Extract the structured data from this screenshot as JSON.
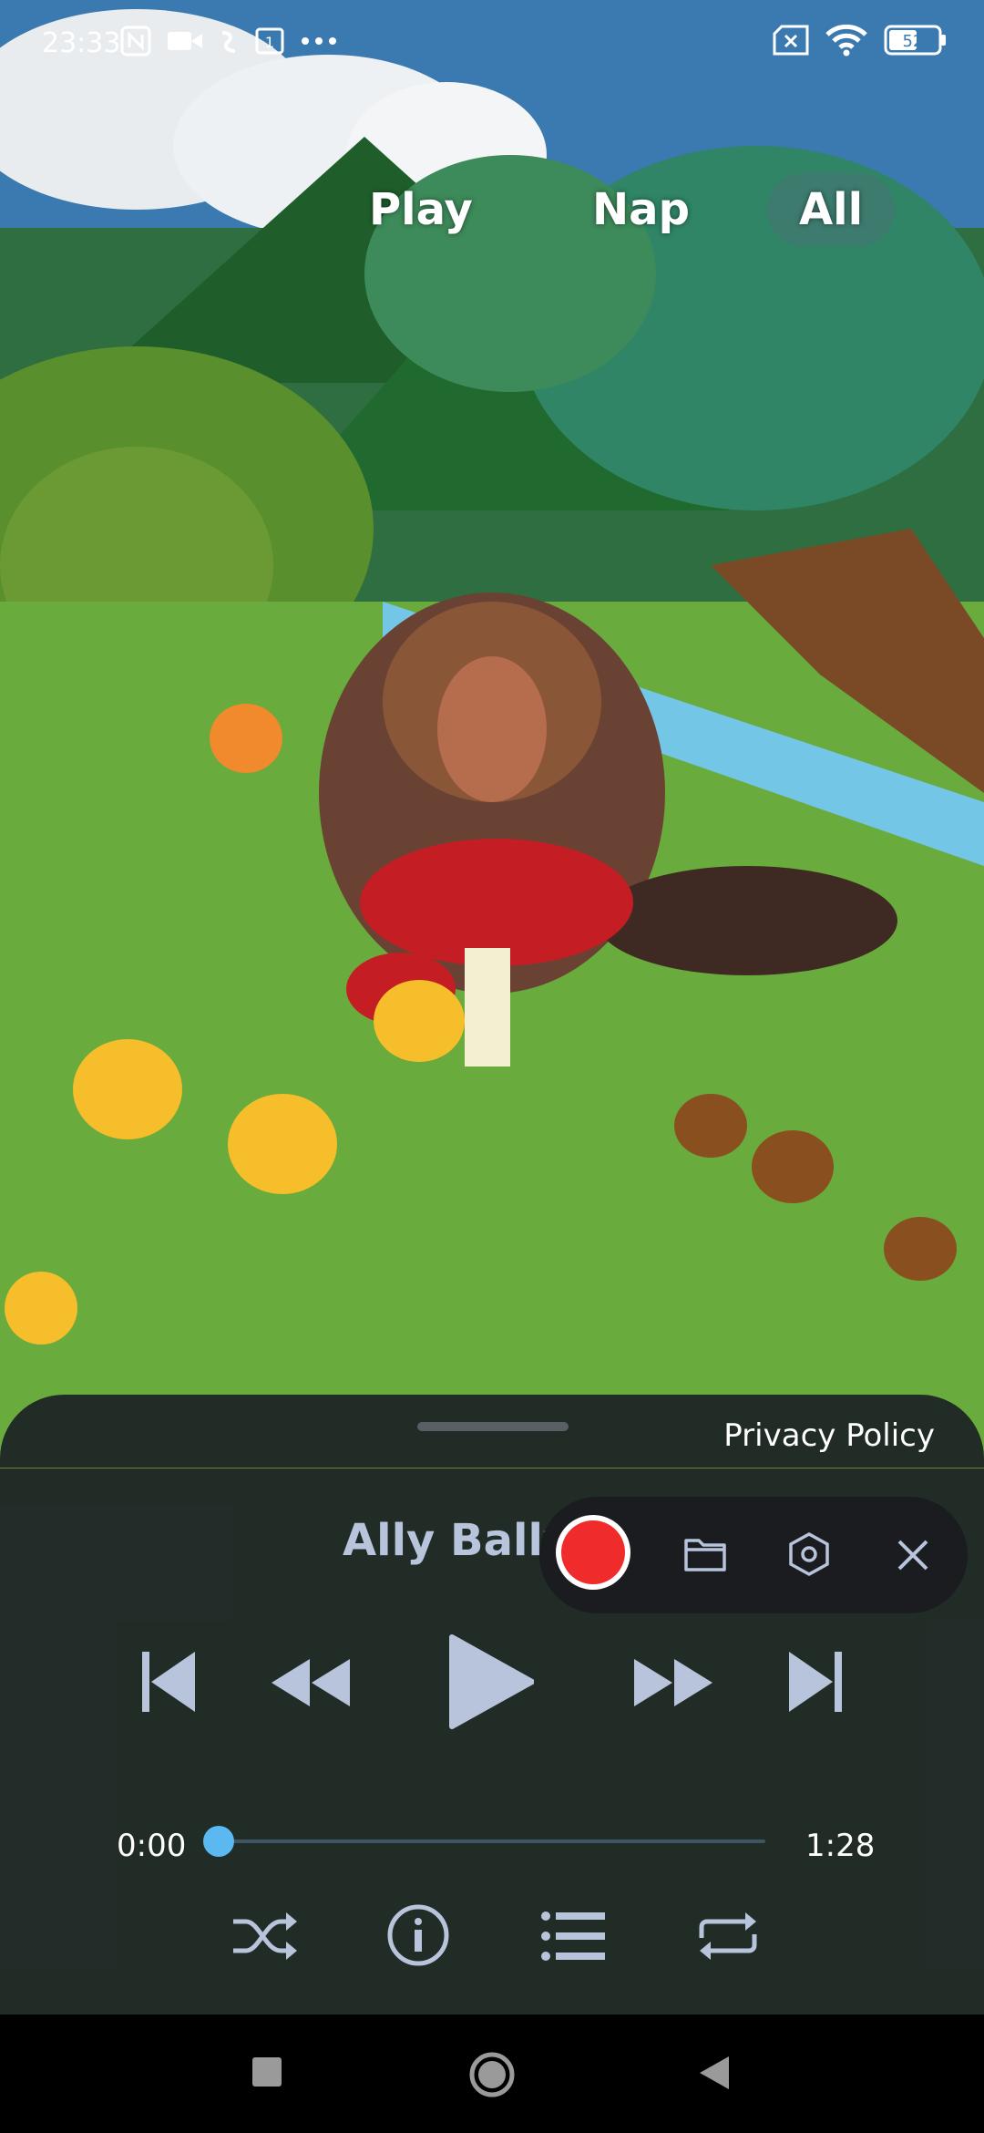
{
  "status_bar": {
    "time": "23:33",
    "battery": "52"
  },
  "tabs": [
    {
      "label": "Play"
    },
    {
      "label": "Nap"
    },
    {
      "label": "All",
      "selected": true
    }
  ],
  "player": {
    "privacy_label": "Privacy Policy",
    "track_title": "Ally Bally",
    "elapsed": "0:00",
    "duration": "1:28",
    "progress_fraction": 0.0
  },
  "colors": {
    "accent": "#5bb8f0",
    "record": "#ef2b2b",
    "control": "#b7c4dc"
  }
}
